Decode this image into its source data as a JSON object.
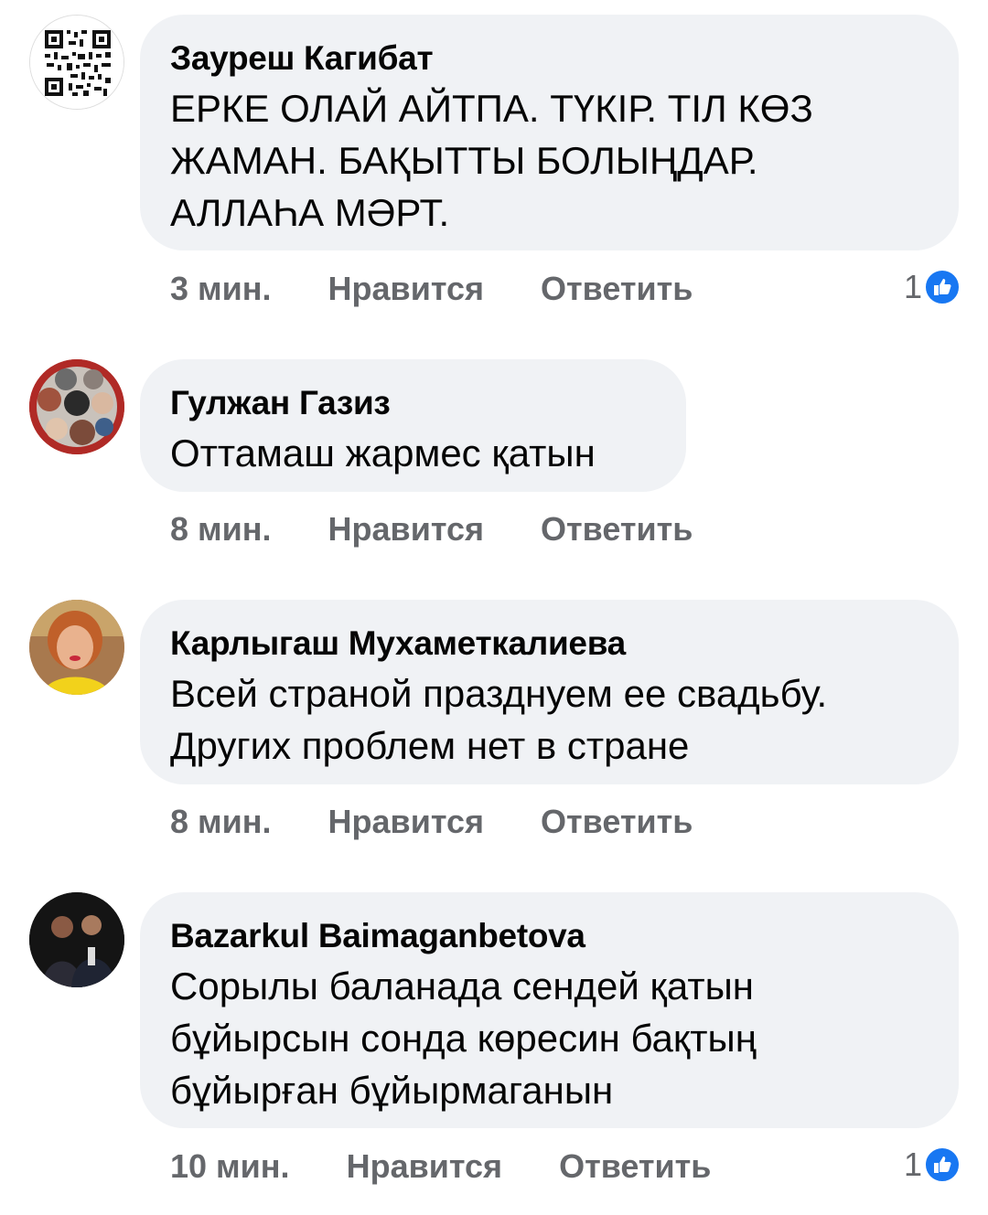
{
  "colors": {
    "bubble_bg": "#f0f2f5",
    "meta_text": "#65676b",
    "like_blue": "#1877f2"
  },
  "comments": [
    {
      "author": "Зауреш Кагибат",
      "lines": [
        "ЕРКЕ ОЛАЙ АЙТПА. ТҮКІР. ТІЛ КӨЗ",
        "ЖАМАН. БАҚЫТТЫ БОЛЫҢДАР.",
        "АЛЛАҺА МӘРТ."
      ],
      "time": "3 мин.",
      "like_label": "Нравится",
      "reply_label": "Ответить",
      "reaction_count": "1",
      "reaction_icon": "like-icon"
    },
    {
      "author": "Гулжан Газиз",
      "lines": [
        "Оттамаш жармес қатын"
      ],
      "time": "8 мин.",
      "like_label": "Нравится",
      "reply_label": "Ответить"
    },
    {
      "author": "Карлыгаш Мухаметкалиева",
      "lines": [
        "Всей страной празднуем ее свадьбу.",
        "Других проблем нет в стране"
      ],
      "time": "8 мин.",
      "like_label": "Нравится",
      "reply_label": "Ответить"
    },
    {
      "author": "Bazarkul Baimaganbetova",
      "lines": [
        "Сорылы баланада сендей қатын",
        "бұйырсын сонда көресин бақтың",
        "бұйырған бұйырмаганын"
      ],
      "time": "10 мин.",
      "like_label": "Нравится",
      "reply_label": "Ответить",
      "reaction_count": "1",
      "reaction_icon": "like-icon"
    }
  ]
}
